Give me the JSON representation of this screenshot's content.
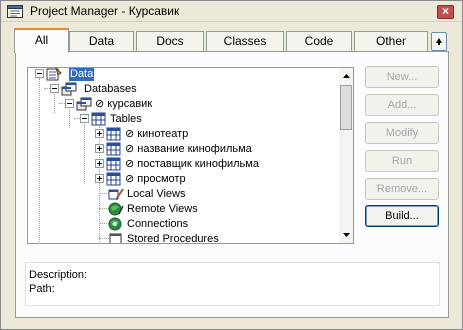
{
  "window": {
    "title": "Project Manager - Курсавик",
    "close_label": "×"
  },
  "tabs": [
    {
      "label": "All",
      "active": true
    },
    {
      "label": "Data",
      "active": false
    },
    {
      "label": "Docs",
      "active": false
    },
    {
      "label": "Classes",
      "active": false
    },
    {
      "label": "Code",
      "active": false
    },
    {
      "label": "Other",
      "active": false
    }
  ],
  "tree": {
    "root": {
      "label": "Data",
      "icon": "data-icon",
      "expanded": true,
      "selected": true
    },
    "databases": {
      "label": "Databases",
      "icon": "databases-icon",
      "expanded": true
    },
    "database": {
      "label": "курсавик",
      "prefix": "⊘",
      "icon": "database-icon",
      "expanded": true
    },
    "tables_group": {
      "label": "Tables",
      "icon": "tables-icon",
      "expanded": true
    },
    "tables": [
      {
        "label": "кинотеатр",
        "prefix": "⊘"
      },
      {
        "label": "название кинофильма",
        "prefix": "⊘"
      },
      {
        "label": "поставщик кинофильма",
        "prefix": "⊘"
      },
      {
        "label": "просмотр",
        "prefix": "⊘"
      }
    ],
    "other_items": [
      {
        "label": "Local Views",
        "icon": "local-views-icon"
      },
      {
        "label": "Remote Views",
        "icon": "remote-views-icon"
      },
      {
        "label": "Connections",
        "icon": "connections-icon"
      },
      {
        "label": "Stored Procedures",
        "icon": "stored-procedures-icon"
      }
    ]
  },
  "buttons": {
    "new": {
      "label": "New...",
      "enabled": false
    },
    "add": {
      "label": "Add...",
      "enabled": false
    },
    "modify": {
      "label": "Modify",
      "enabled": false
    },
    "run": {
      "label": "Run",
      "enabled": false
    },
    "remove": {
      "label": "Remove...",
      "enabled": false
    },
    "build": {
      "label": "Build...",
      "enabled": true
    }
  },
  "details": {
    "description_label": "Description:",
    "path_label": "Path:"
  },
  "colors": {
    "selection": "#316ac5",
    "tab_accent": "#e68b2c",
    "close_button": "#c0504d",
    "window_bg": "#ece9d8"
  }
}
